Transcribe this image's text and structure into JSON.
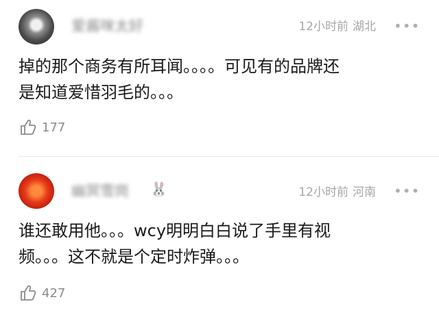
{
  "comments": [
    {
      "username": "爱酱咪太好",
      "time": "12小时前",
      "location": "湖北",
      "text_line1": "掉的那个商务有所耳闻。。。。可见有的品牌还",
      "text_line2": "是知道爱惜羽毛的。。。",
      "likes": "177",
      "more_icon": "more-dots-icon"
    },
    {
      "username": "幽冥雪岗",
      "badge": "🐰",
      "time": "12小时前",
      "location": "河南",
      "text_line1": "谁还敢用他。。。wcy明明白白说了手里有视",
      "text_line2": "频。。。这不就是个定时炸弹。。。",
      "likes": "427",
      "more_icon": "more-dots-icon"
    }
  ]
}
